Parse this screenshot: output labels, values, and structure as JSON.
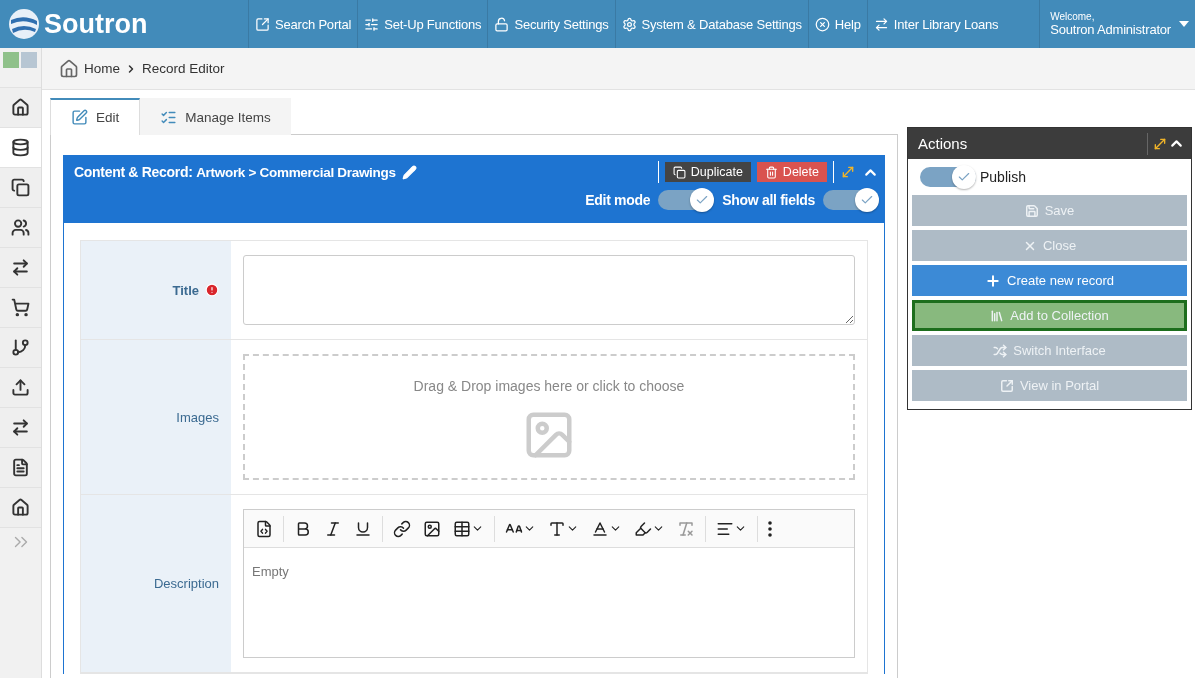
{
  "topbar": {
    "logo": "Soutron",
    "nav": [
      {
        "label": "Search Portal"
      },
      {
        "label": "Set-Up Functions"
      },
      {
        "label": "Security Settings"
      },
      {
        "label": "System & Database Settings"
      },
      {
        "label": "Help"
      },
      {
        "label": "Inter Library Loans"
      }
    ],
    "user": {
      "greeting": "Welcome,",
      "name": "Soutron Administrator"
    }
  },
  "sidebar": {
    "swatches": [
      {
        "color": "#8fc18a"
      },
      {
        "color": "#b7c6d3"
      }
    ],
    "items": [
      {
        "selected": false
      },
      {
        "selected": true
      },
      {
        "selected": false
      },
      {
        "selected": false
      },
      {
        "selected": false
      },
      {
        "selected": false
      },
      {
        "selected": false
      },
      {
        "selected": false
      },
      {
        "selected": false
      },
      {
        "selected": false
      },
      {
        "selected": false
      }
    ]
  },
  "breadcrumb": [
    "Home",
    "Record Editor"
  ],
  "tabs": [
    {
      "label": "Edit",
      "selected": true
    },
    {
      "label": "Manage Items",
      "selected": false
    }
  ],
  "record": {
    "heading": "Content & Record:",
    "path": "Artwork > Commercial Drawings",
    "buttons": [
      {
        "label": "Duplicate",
        "kind": "dark"
      },
      {
        "label": "Delete",
        "kind": "danger"
      }
    ],
    "toggles": [
      {
        "label": "Edit mode",
        "on": true
      },
      {
        "label": "Show all fields",
        "on": true
      }
    ],
    "fields": [
      {
        "label": "Title",
        "kind": "textarea",
        "required": true
      },
      {
        "label": "Images",
        "kind": "dropzone",
        "required": false,
        "prompt": "Drag & Drop images here or click to choose"
      },
      {
        "label": "Description",
        "kind": "editor",
        "required": false,
        "placeholder": "Empty"
      }
    ]
  },
  "actions": {
    "title": "Actions",
    "publish": {
      "label": "Publish",
      "on": true
    },
    "buttons": [
      {
        "label": "Save",
        "kind": "muted"
      },
      {
        "label": "Close",
        "kind": "muted"
      },
      {
        "label": "Create new record",
        "kind": "primary"
      },
      {
        "label": "Add to Collection",
        "kind": "highlight"
      },
      {
        "label": "Switch Interface",
        "kind": "muted"
      },
      {
        "label": "View in Portal",
        "kind": "muted"
      }
    ]
  }
}
